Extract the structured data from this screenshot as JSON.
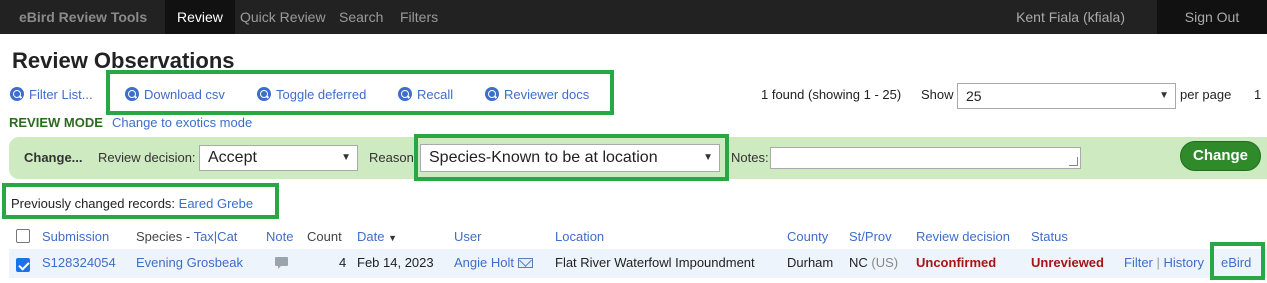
{
  "nav": {
    "brand": "eBird Review Tools",
    "items": [
      "Review",
      "Quick Review",
      "Search",
      "Filters"
    ],
    "user": "Kent Fiala (kfiala)",
    "signout": "Sign Out"
  },
  "page_title": "Review Observations",
  "toolbar": {
    "filter_list": "Filter List...",
    "download_csv": "Download csv",
    "toggle_deferred": "Toggle deferred",
    "recall": "Recall",
    "reviewer_docs": "Reviewer docs"
  },
  "paging": {
    "found": "1 found (showing 1 - 25)",
    "show_label": "Show",
    "show_value": "25",
    "per_page": "per page",
    "page": "1"
  },
  "mode": {
    "label": "REVIEW MODE",
    "change_link": "Change to exotics mode"
  },
  "change_bar": {
    "title": "Change...",
    "decision_label": "Review decision:",
    "decision_value": "Accept",
    "reason_label": "Reason",
    "reason_value": "Species-Known to be at location",
    "notes_label": "Notes:",
    "notes_value": "",
    "button": "Change"
  },
  "previous": {
    "label": "Previously changed records:",
    "link": "Eared Grebe"
  },
  "table": {
    "headers": {
      "submission": "Submission",
      "species": "Species - ",
      "taxcat": "Tax|Cat",
      "note": "Note",
      "count": "Count",
      "date": "Date",
      "user": "User",
      "location": "Location",
      "county": "County",
      "stprov": "St/Prov",
      "review_decision": "Review decision",
      "status": "Status"
    },
    "row": {
      "submission": "S128324054",
      "species": "Evening Grosbeak",
      "count": "4",
      "date": "Feb 14, 2023",
      "user": "Angie Holt",
      "location": "Flat River Waterfowl Impoundment",
      "county": "Durham",
      "state": "NC",
      "country": "(US)",
      "review_decision": "Unconfirmed",
      "status": "Unreviewed",
      "filter": "Filter",
      "history": "History",
      "ebird": "eBird"
    }
  },
  "colors": {
    "highlight": "#27a844",
    "link": "#3d6ec9",
    "change_bar": "#cdeac0",
    "change_button": "#2f8a2a",
    "alert_red": "#a61414"
  }
}
